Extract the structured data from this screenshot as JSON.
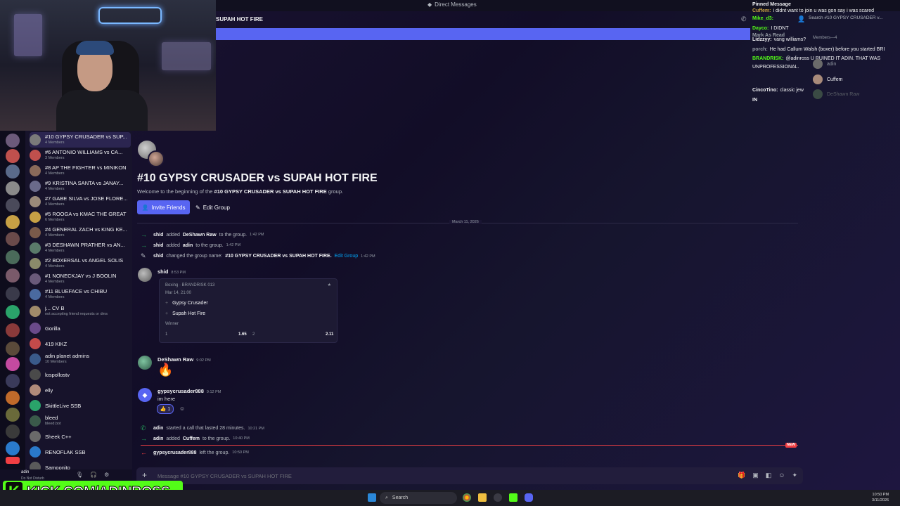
{
  "window": {
    "title": "Direct Messages"
  },
  "header": {
    "channel": "SUPAH HOT FIRE",
    "search_placeholder": "Search #10 GYPSY CRUSADER v..."
  },
  "dm_list": [
    {
      "name": "#10 GYPSY CRUSADER vs SUP...",
      "sub": "4 Members",
      "active": true
    },
    {
      "name": "#6 ANTONIO WILLIAMS vs CA...",
      "sub": "3 Members"
    },
    {
      "name": "#8 AP THE FIGHTER vs MINIKON",
      "sub": "4 Members"
    },
    {
      "name": "#9 KRISTINA SANTA vs JANAY...",
      "sub": "4 Members"
    },
    {
      "name": "#7 GABE SILVA vs JOSE FLORE...",
      "sub": "4 Members"
    },
    {
      "name": "#5 ROOGA vs KMAC THE GREAT",
      "sub": "6 Members"
    },
    {
      "name": "#4 GENERAL ZACH vs KING KE...",
      "sub": "4 Members"
    },
    {
      "name": "#3 DESHAWN PRATHER vs AN...",
      "sub": "4 Members"
    },
    {
      "name": "#2 BOXERSAL vs ANGEL SOLIS",
      "sub": "4 Members"
    },
    {
      "name": "#1 NONECKJAY vs J BOOLIN",
      "sub": "4 Members"
    },
    {
      "name": "#11 BLUEFACE vs CHIBU",
      "sub": "4 Members"
    },
    {
      "name": "j... CV B",
      "sub": "not accepting friend requests or dms"
    },
    {
      "name": "Gorilla",
      "sub": ""
    },
    {
      "name": "419 KIKZ",
      "sub": ""
    },
    {
      "name": "adin planet admins",
      "sub": "10 Members"
    },
    {
      "name": "lospollostv",
      "sub": ""
    },
    {
      "name": "elly",
      "sub": ""
    },
    {
      "name": "SkittleLive SSB",
      "sub": ""
    },
    {
      "name": "bleed",
      "sub": "bleed.bot"
    },
    {
      "name": "Sheek C++",
      "sub": ""
    },
    {
      "name": "RENOFLAK SSB",
      "sub": ""
    },
    {
      "name": "Samoonito",
      "sub": ""
    }
  ],
  "group": {
    "title": "#10 GYPSY CRUSADER vs SUPAH HOT FIRE",
    "welcome_pre": "Welcome to the beginning of the",
    "welcome_name": "#10 GYPSY CRUSADER vs SUPAH HOT FIRE",
    "welcome_post": "group.",
    "invite_label": "Invite Friends",
    "edit_label": "Edit Group"
  },
  "date_separator": "March 11, 2026",
  "system_messages": [
    {
      "actor": "shid",
      "text": "added",
      "target": "DeShawn Raw",
      "tail": "to the group.",
      "ts": "1:42 PM"
    },
    {
      "actor": "shid",
      "text": "added",
      "target": "adin",
      "tail": "to the group.",
      "ts": "1:42 PM"
    },
    {
      "actor": "shid",
      "text": "changed the group name:",
      "target": "#10 GYPSY CRUSADER vs SUPAH HOT FIRE.",
      "tail": "Edit Group",
      "ts": "1:42 PM"
    }
  ],
  "embed": {
    "header": "Boxing · BRANDRISK 013",
    "date": "Mar 14, 21:00",
    "opt1": "Gypsy Crusader",
    "opt2": "Supah Hot Fire",
    "winner_label": "Winner",
    "odds1_label": "1",
    "odds1": "1.65",
    "odds2_label": "2",
    "odds2": "2.11"
  },
  "messages": [
    {
      "author": "shid",
      "ts": "8:53 PM"
    },
    {
      "author": "DeShawn Raw",
      "ts": "9:02 PM",
      "text": "🔥"
    },
    {
      "author": "gypsycrusader888",
      "ts": "9:12 PM",
      "text": "im here",
      "reaction": "👍 1"
    }
  ],
  "late_system": [
    {
      "actor": "adin",
      "text": "started a call that lasted 28 minutes.",
      "ts": "10:21 PM"
    },
    {
      "actor": "adin",
      "text": "added",
      "target": "Cuffem",
      "tail": "to the group.",
      "ts": "10:40 PM"
    },
    {
      "actor": "gypsycrusader888",
      "text": "left the group.",
      "ts": "10:50 PM"
    }
  ],
  "new_tag": "NEW",
  "composer": {
    "placeholder": "Message #10 GYPSY CRUSADER vs SUPAH HOT FIRE"
  },
  "chat_overlay": [
    {
      "user": "Pinned Message",
      "msg": ""
    },
    {
      "user": "Cuffem:",
      "msg": "i didnt want to join u was gon say i was scared"
    },
    {
      "user": "Mike_d3:",
      "msg": ""
    },
    {
      "user": "Dayco:",
      "msg": "I DIDNT"
    },
    {
      "user": "Mark As Read",
      "msg": ""
    },
    {
      "user": "Lidzzyy:",
      "msg": "vang williams?"
    },
    {
      "user": "porch:",
      "msg": "He had Callum Walsh (boxer) before you started BRI"
    },
    {
      "user": "BRANDRISK:",
      "msg": "@adinross U RUINED IT ADIN. THAT WAS UNPROFESSIONAL."
    },
    {
      "user": "CincoTino:",
      "msg": "classic jew"
    },
    {
      "user": "IN",
      "msg": ""
    }
  ],
  "members": {
    "heading": "Members—4",
    "list": [
      "adin",
      "Cuffem",
      "DeShawn Raw"
    ]
  },
  "user_panel": {
    "name": "adin",
    "status": "Do Not Disturb"
  },
  "kick_banner": "KICK.COM/ADINROSS",
  "taskbar": {
    "search_label": "Search",
    "time": "10:50 PM",
    "date": "3/11/2026"
  },
  "colors": {
    "accent": "#5865f2",
    "kick_green": "#53fc18",
    "new_red": "#f23f43"
  }
}
